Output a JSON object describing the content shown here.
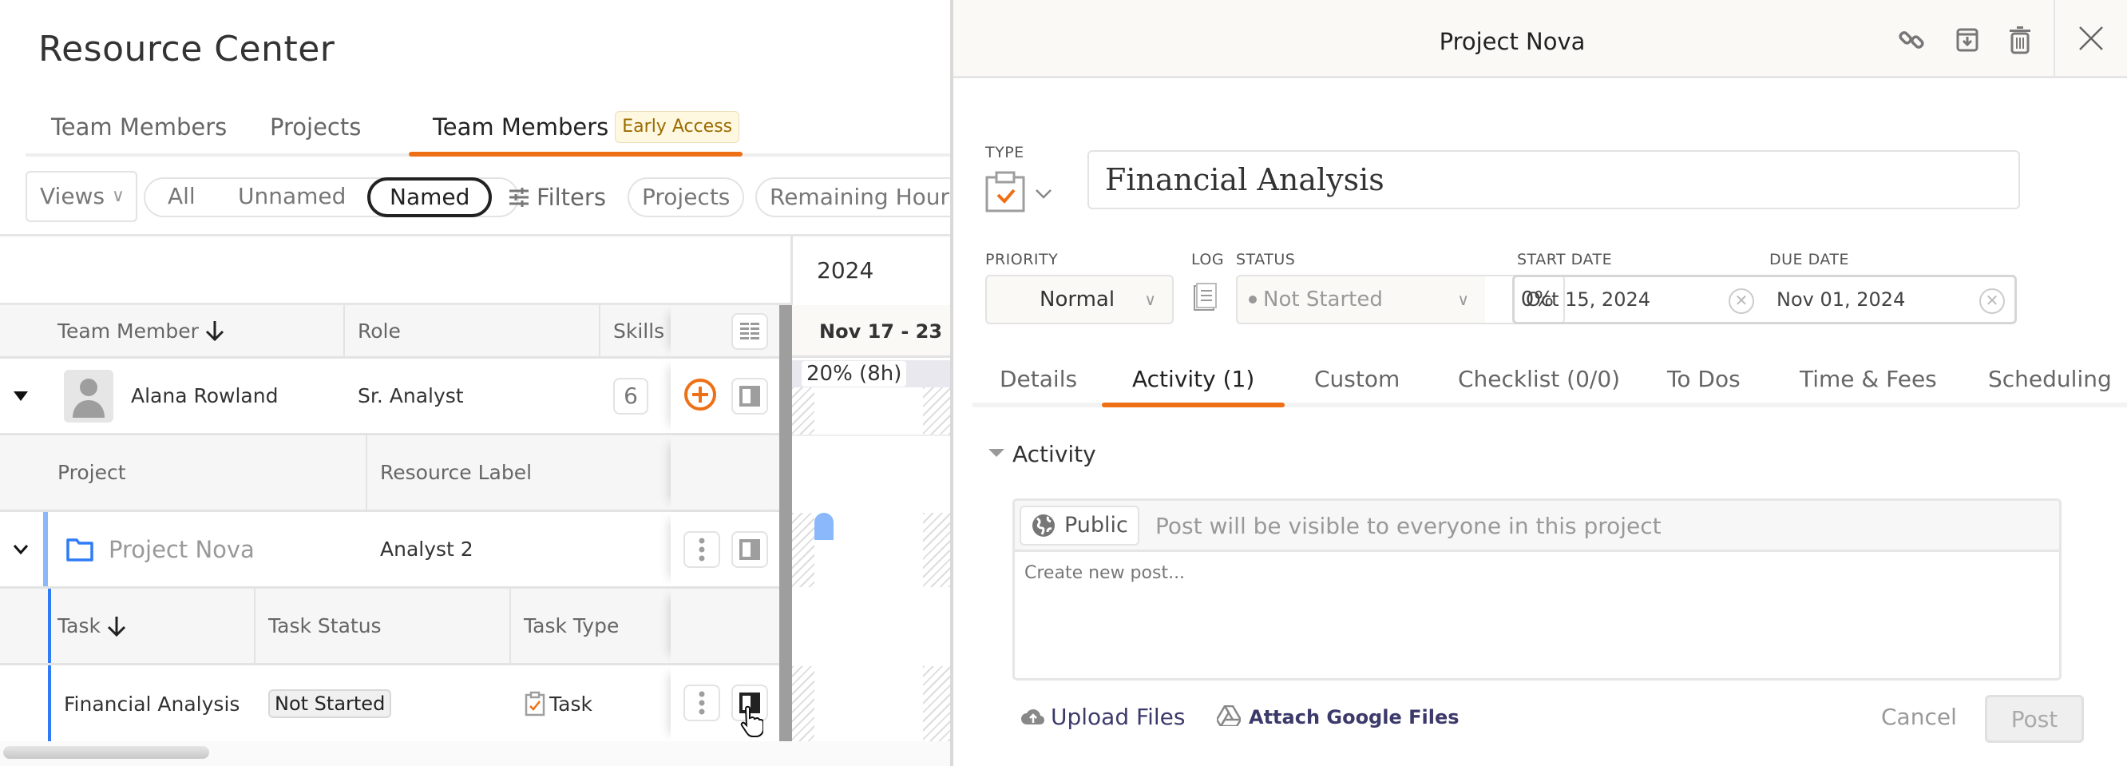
{
  "page": {
    "title": "Resource Center"
  },
  "top_tabs": [
    {
      "label": "Team Members",
      "active": false
    },
    {
      "label": "Projects",
      "active": false
    },
    {
      "label": "Team Members",
      "active": true,
      "badge": "Early Access"
    }
  ],
  "filters": {
    "views_label": "Views",
    "segments": [
      "All",
      "Unnamed",
      "Named"
    ],
    "active_segment": "Named",
    "filters_label": "Filters",
    "pills": [
      "Projects",
      "Remaining Hours"
    ]
  },
  "timeline": {
    "year": "2024",
    "week": "Nov 17 - 23",
    "utilization": "20% (8h)"
  },
  "grid": {
    "member_header": {
      "team_member": "Team Member",
      "role": "Role",
      "skills": "Skills"
    },
    "member": {
      "name": "Alana Rowland",
      "role": "Sr. Analyst",
      "skills_count": "6"
    },
    "project_header": {
      "project": "Project",
      "resource_label": "Resource Label"
    },
    "project": {
      "name": "Project Nova",
      "resource_label": "Analyst 2"
    },
    "task_header": {
      "task": "Task",
      "task_status": "Task Status",
      "task_type": "Task Type"
    },
    "task": {
      "name": "Financial Analysis",
      "status": "Not Started",
      "type": "Task"
    }
  },
  "detail": {
    "header_title": "Project Nova",
    "type_label": "TYPE",
    "task_title": "Financial Analysis",
    "priority_label": "PRIORITY",
    "priority_value": "Normal",
    "log_label": "LOG",
    "status_label": "STATUS",
    "status_value": "Not Started",
    "percent_complete": "0%",
    "start_date_label": "START DATE",
    "start_date": "Oct 15, 2024",
    "due_date_label": "DUE DATE",
    "due_date": "Nov 01, 2024",
    "tabs": [
      {
        "label": "Details",
        "active": false
      },
      {
        "label": "Activity (1)",
        "active": true
      },
      {
        "label": "Custom",
        "active": false
      },
      {
        "label": "Checklist (0/0)",
        "active": false
      },
      {
        "label": "To Dos",
        "active": false
      },
      {
        "label": "Time & Fees",
        "active": false
      },
      {
        "label": "Scheduling",
        "active": false
      }
    ],
    "activity": {
      "section_title": "Activity",
      "visibility_button": "Public",
      "visibility_note": "Post will be visible to everyone in this project",
      "post_placeholder": "Create new post...",
      "upload_label": "Upload Files",
      "google_label": "Attach Google Files",
      "cancel_label": "Cancel",
      "post_label": "Post"
    }
  },
  "colors": {
    "accent": "#ee7016",
    "project_blue": "#2f7cf6",
    "bar_blue": "#8ab8fb"
  }
}
